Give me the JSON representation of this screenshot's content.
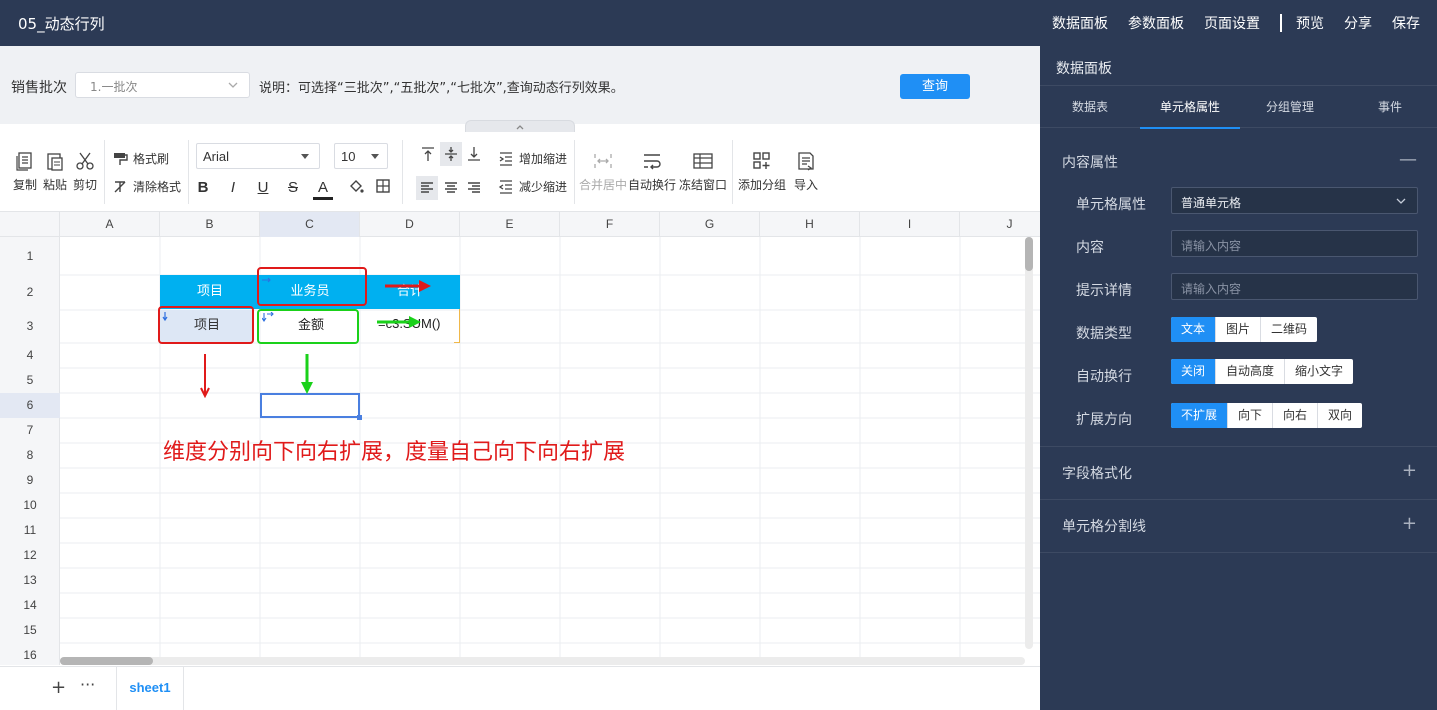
{
  "app": {
    "title": "05_动态行列"
  },
  "topnav": {
    "data_panel": "数据面板",
    "param_panel": "参数面板",
    "page_settings": "页面设置",
    "preview": "预览",
    "share": "分享",
    "save": "保存"
  },
  "query": {
    "label": "销售批次",
    "select_value": "1.一批次",
    "description": "说明：可选择“三批次”,“五批次”,“七批次”,查询动态行列效果。",
    "button": "查询"
  },
  "toolbar": {
    "copy": "复制",
    "paste": "粘贴",
    "cut": "剪切",
    "format_painter": "格式刷",
    "clear_format": "清除格式",
    "font": "Arial",
    "font_size": "10",
    "bold": "B",
    "italic": "I",
    "underline": "U",
    "strike": "S",
    "font_color": "A",
    "indent_increase": "增加缩进",
    "indent_decrease": "减少缩进",
    "merge_center": "合并居中",
    "auto_wrap": "自动换行",
    "freeze": "冻结窗口",
    "add_group": "添加分组",
    "import": "导入"
  },
  "sheet": {
    "columns": [
      "A",
      "B",
      "C",
      "D",
      "E",
      "F",
      "G",
      "H",
      "I",
      "J"
    ],
    "rows": [
      "1",
      "2",
      "3",
      "4",
      "5",
      "6",
      "7",
      "8",
      "9",
      "10",
      "11",
      "12",
      "13",
      "14",
      "15",
      "16"
    ],
    "cells": {
      "b2": "项目",
      "c2": "业务员",
      "d2": "合计",
      "b3": "项目",
      "c3": "金额",
      "d3": "=c3.SUM()"
    },
    "annotation": "维度分别向下向右扩展，度量自己向下向右扩展",
    "tab": "sheet1"
  },
  "panel": {
    "title": "数据面板",
    "tabs": [
      "数据表",
      "单元格属性",
      "分组管理",
      "事件"
    ],
    "content_section": "内容属性",
    "cell_attr_label": "单元格属性",
    "cell_attr_value": "普通单元格",
    "content_label": "内容",
    "content_placeholder": "请输入内容",
    "tip_label": "提示详情",
    "tip_placeholder": "请输入内容",
    "data_type_label": "数据类型",
    "data_type_options": [
      "文本",
      "图片",
      "二维码"
    ],
    "wrap_label": "自动换行",
    "wrap_options": [
      "关闭",
      "自动高度",
      "缩小文字"
    ],
    "expand_label": "扩展方向",
    "expand_options": [
      "不扩展",
      "向下",
      "向右",
      "双向"
    ],
    "field_format_section": "字段格式化",
    "divider_section": "单元格分割线",
    "collapse_symbol": "—",
    "expand_symbol": "+"
  },
  "colors": {
    "accent": "#1f8ff5",
    "header_cell": "#00b0f0",
    "annotation_red": "#e01a1a",
    "annotation_green": "#1ad11a",
    "topbar": "#2c3a55"
  }
}
